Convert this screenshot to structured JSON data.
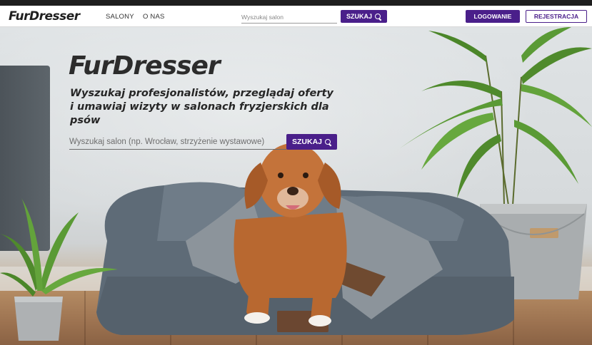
{
  "navbar": {
    "logo": "FurDresser",
    "links": [
      {
        "label": "SALONY"
      },
      {
        "label": "O NAS"
      }
    ],
    "search": {
      "placeholder": "Wyszukaj salon",
      "button_label": "SZUKAJ",
      "button_icon": "search-icon"
    },
    "login_label": "LOGOWANIE",
    "register_label": "REJESTRACJA"
  },
  "hero": {
    "title": "FurDresser",
    "subtitle": "Wyszukaj profesjonalistów, przeglądaj oferty i umawiaj wizyty w salonach fryzjerskich dla psów",
    "search": {
      "placeholder": "Wyszukaj salon (np. Wrocław, strzyżenie wystawowe)",
      "button_label": "SZUKAJ",
      "button_icon": "search-icon"
    }
  },
  "colors": {
    "accent": "#4a1f8a",
    "navbar_bg": "#ffffff",
    "logo_text": "#1f1f1f"
  }
}
